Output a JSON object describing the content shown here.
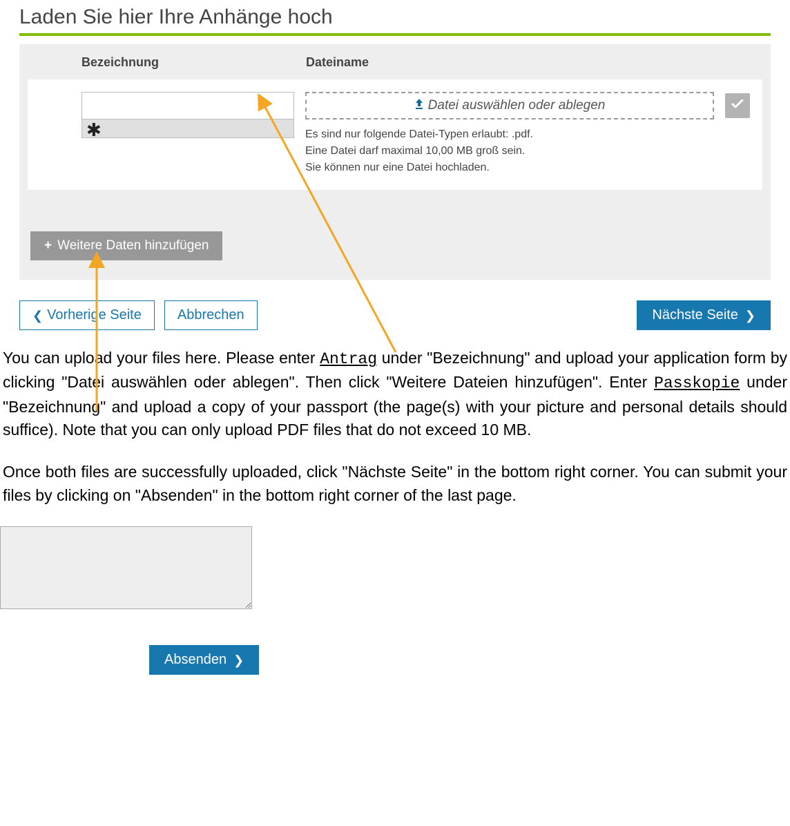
{
  "heading": "Laden Sie hier Ihre Anhänge hoch",
  "columns": {
    "bezeichnung": "Bezeichnung",
    "dateiname": "Dateiname"
  },
  "row": {
    "bezeichnung_value": "",
    "required_marker": "✱",
    "dropzone_text": "Datei auswählen oder ablegen",
    "hints": {
      "line1": "Es sind nur folgende Datei-Typen erlaubt: .pdf.",
      "line2": "Eine Datei darf maximal 10,00 MB groß sein.",
      "line3": "Sie können nur eine Datei hochladen."
    }
  },
  "add_more_label": "Weitere Daten hinzufügen",
  "nav": {
    "prev": "Vorherige Seite",
    "cancel": "Abbrechen",
    "next": "Nächste Seite"
  },
  "instructions": {
    "p1a": "You can upload your files here. Please enter ",
    "p1_mono1": "Antrag",
    "p1b": " under \"Bezeichnung\" and upload your application form by clicking \"Datei auswählen oder ablegen\". Then click \"Weitere Dateien hinzufügen\". Enter ",
    "p1_mono2": "Passkopie",
    "p1c": " under \"Bezeichnung\" and upload a copy of your passport (the page(s) with your picture and personal details should suffice). Note that you can only upload PDF files that do not exceed 10 MB.",
    "p2": "Once both files are successfully uploaded, click \"Nächste Seite\" in the bottom right corner. You can submit your files by clicking on \"Absenden\" in the bottom right corner of the last page."
  },
  "submit_label": "Absenden",
  "colors": {
    "accent_green": "#7fbf00",
    "primary_blue": "#1777af",
    "annotation_orange": "#f4a623"
  }
}
